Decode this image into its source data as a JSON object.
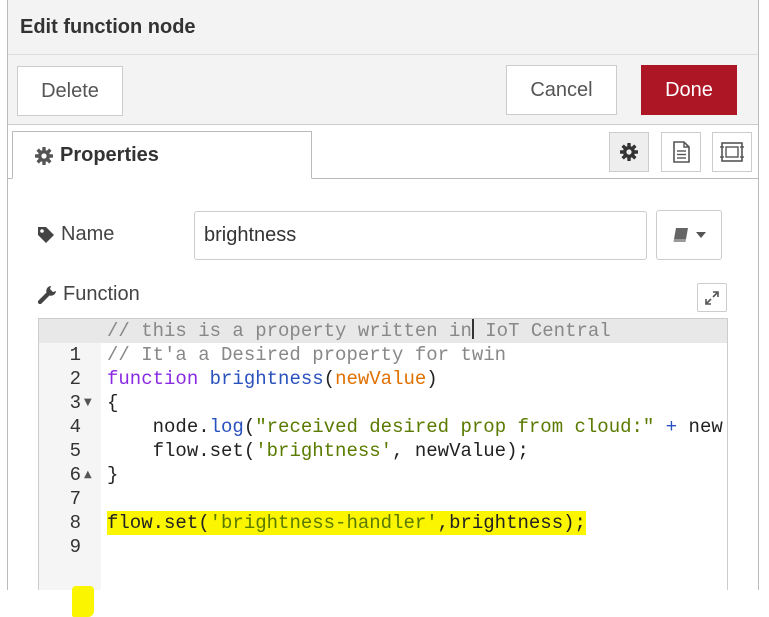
{
  "tray": {
    "title": "Edit function node"
  },
  "toolbar": {
    "delete_label": "Delete",
    "cancel_label": "Cancel",
    "done_label": "Done"
  },
  "tabs": {
    "properties_label": "Properties",
    "properties_icon": "gear-icon",
    "buttons": [
      {
        "icon": "gear-icon",
        "active": true
      },
      {
        "icon": "description-icon",
        "active": false
      },
      {
        "icon": "appearance-icon",
        "active": false
      }
    ]
  },
  "form": {
    "name_label": "Name",
    "name_icon": "tag-icon",
    "name_value": "brightness",
    "library_icon": "book-icon",
    "function_label": "Function",
    "function_icon": "wrench-icon"
  },
  "editor": {
    "line_numbers": [
      "1",
      "2",
      "3",
      "4",
      "5",
      "6",
      "7",
      "8",
      "9"
    ],
    "highlighted_line": "9",
    "lines": {
      "l1_part1": "// this is a property written in",
      "l1_part2": " IoT Central",
      "l2": "// It'a a Desired property for twin",
      "l3_kw": "function",
      "l3_name": "brightness",
      "l3_param": "newValue",
      "l4": "{",
      "l5_obj": "    node.",
      "l5_fn": "log",
      "l5_str": "\"received desired prop from cloud:\"",
      "l5_op": " + ",
      "l5_rest": "new",
      "l6_code": "    flow.set(",
      "l6_str": "'brightness'",
      "l6_rest": ", newValue);",
      "l7": "}",
      "l9_code": "flow.set(",
      "l9_str": "'brightness-handler'",
      "l9_rest": ",brightness);"
    }
  },
  "colors": {
    "done_button": "#ad1625",
    "highlight": "#fbf500",
    "comment": "#888888",
    "keyword": "#8a2be2",
    "string": "#5a7a00",
    "param": "#e07000"
  }
}
